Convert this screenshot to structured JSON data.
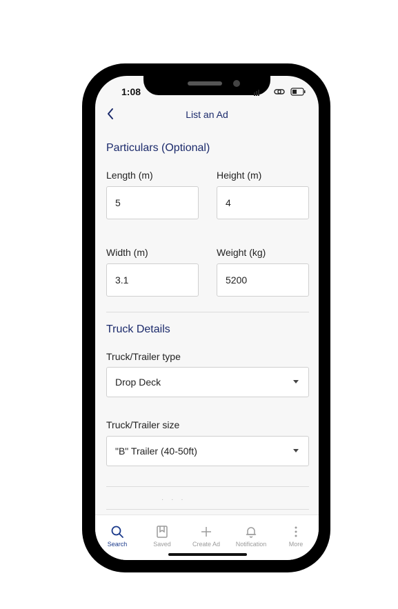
{
  "status_bar": {
    "time": "1:08"
  },
  "header": {
    "back_icon": "chevron-left-icon",
    "title": "List an Ad"
  },
  "particulars": {
    "title": "Particulars (Optional)",
    "length": {
      "label": "Length (m)",
      "value": "5"
    },
    "height": {
      "label": "Height (m)",
      "value": "4"
    },
    "width": {
      "label": "Width (m)",
      "value": "3.1"
    },
    "weight": {
      "label": "Weight (kg)",
      "value": "5200"
    }
  },
  "truck": {
    "title": "Truck Details",
    "type": {
      "label": "Truck/Trailer type",
      "value": "Drop Deck"
    },
    "size": {
      "label": "Truck/Trailer size",
      "value": "\"B\" Trailer (40-50ft)"
    }
  },
  "tabs": [
    {
      "label": "Search",
      "icon": "search-icon",
      "active": true
    },
    {
      "label": "Saved",
      "icon": "bookmark-icon",
      "active": false
    },
    {
      "label": "Create Ad",
      "icon": "plus-icon",
      "active": false
    },
    {
      "label": "Notification",
      "icon": "bell-icon",
      "active": false
    },
    {
      "label": "More",
      "icon": "more-vertical-icon",
      "active": false
    }
  ],
  "colors": {
    "accent": "#1b2a6b",
    "active_tab": "#1b3a8b",
    "inactive_tab": "#9a9a9a"
  }
}
